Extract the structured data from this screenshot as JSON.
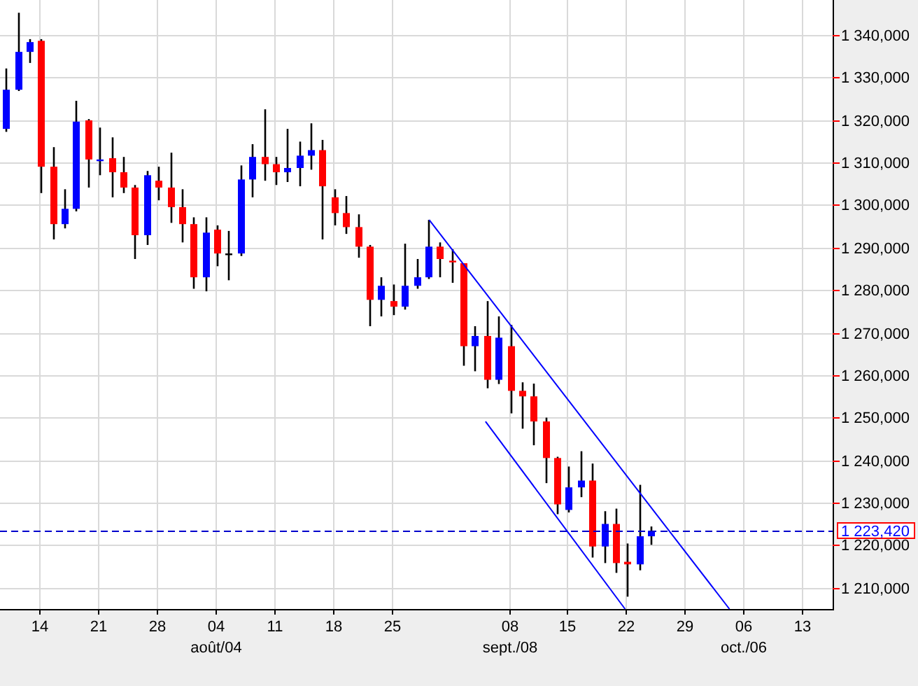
{
  "chart": {
    "y_axis_labels": [
      "1 340,000",
      "1 330,000",
      "1 320,000",
      "1 310,000",
      "1 300,000",
      "1 290,000",
      "1 280,000",
      "1 270,000",
      "1 260,000",
      "1 250,000",
      "1 240,000",
      "1 230,000",
      "1 220,000",
      "1 210,000"
    ],
    "x_axis_labels": [
      "14",
      "21",
      "28",
      "04",
      "11",
      "18",
      "25",
      "08",
      "15",
      "22",
      "29",
      "06",
      "13"
    ],
    "month_labels": [
      "août/04",
      "sept./08",
      "oct./06"
    ],
    "price_marker": {
      "label": "1 223,420"
    }
  }
}
